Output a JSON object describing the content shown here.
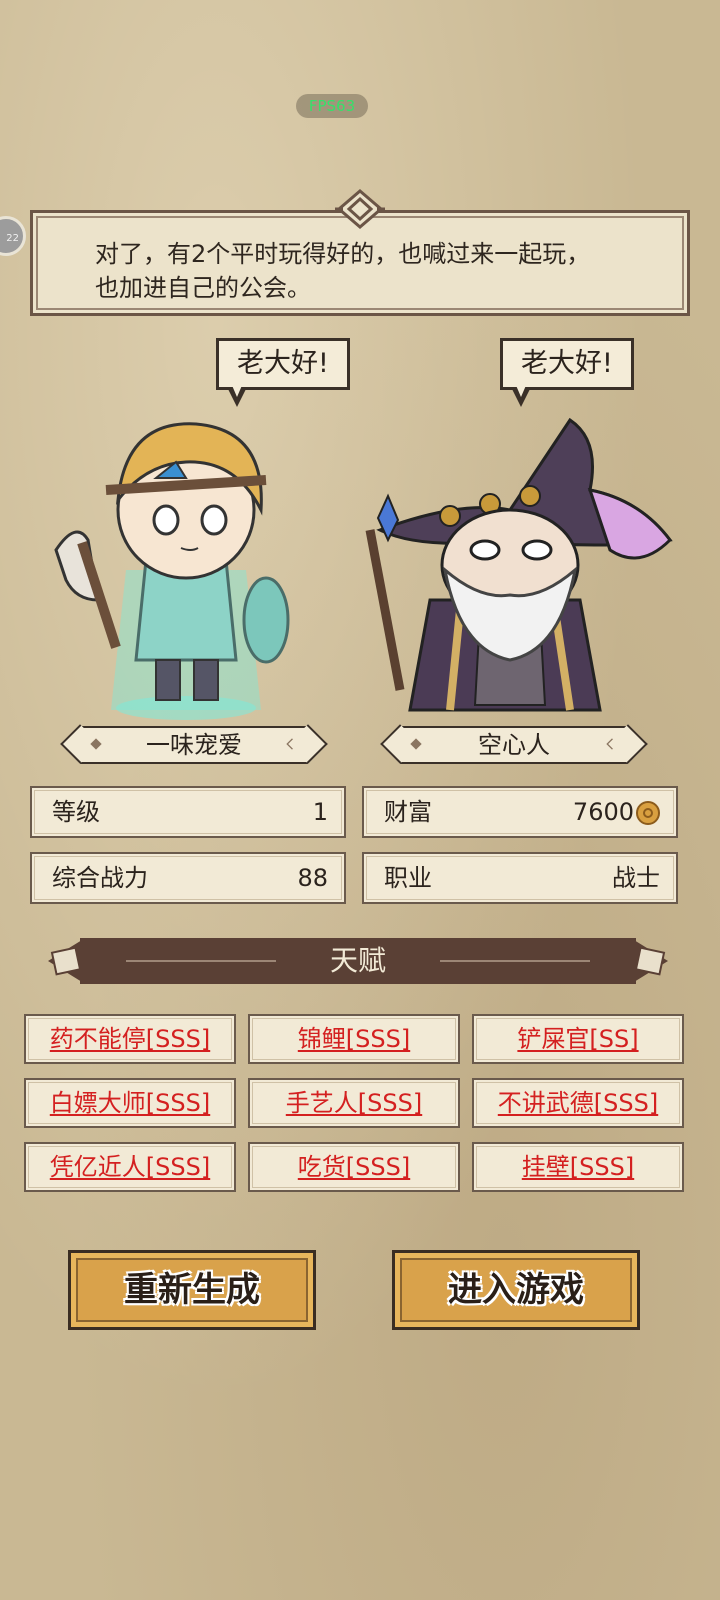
{
  "fps": "FPS63",
  "edge_badge": "22",
  "dialog": {
    "line1": "对了，有2个平时玩得好的，也喊过来一起玩，",
    "line2": "也加进自己的公会。"
  },
  "characters": [
    {
      "speech": "老大好!",
      "name": "一味宠爱"
    },
    {
      "speech": "老大好!",
      "name": "空心人"
    }
  ],
  "stats": {
    "level_label": "等级",
    "level_value": "1",
    "wealth_label": "财富",
    "wealth_value": "7600",
    "power_label": "综合战力",
    "power_value": "88",
    "job_label": "职业",
    "job_value": "战士"
  },
  "talent_title": "天赋",
  "talents": [
    "药不能停[SSS]",
    "锦鲤[SSS]",
    "铲屎官[SS]",
    "白嫖大师[SSS]",
    "手艺人[SSS]",
    "不讲武德[SSS]",
    "凭亿近人[SSS]",
    "吃货[SSS]",
    "挂壁[SSS]"
  ],
  "buttons": {
    "regenerate": "重新生成",
    "enter": "进入游戏"
  },
  "colors": {
    "talent_text": "#d42020",
    "button_fill": "#d9a24b",
    "banner": "#5a4035"
  }
}
